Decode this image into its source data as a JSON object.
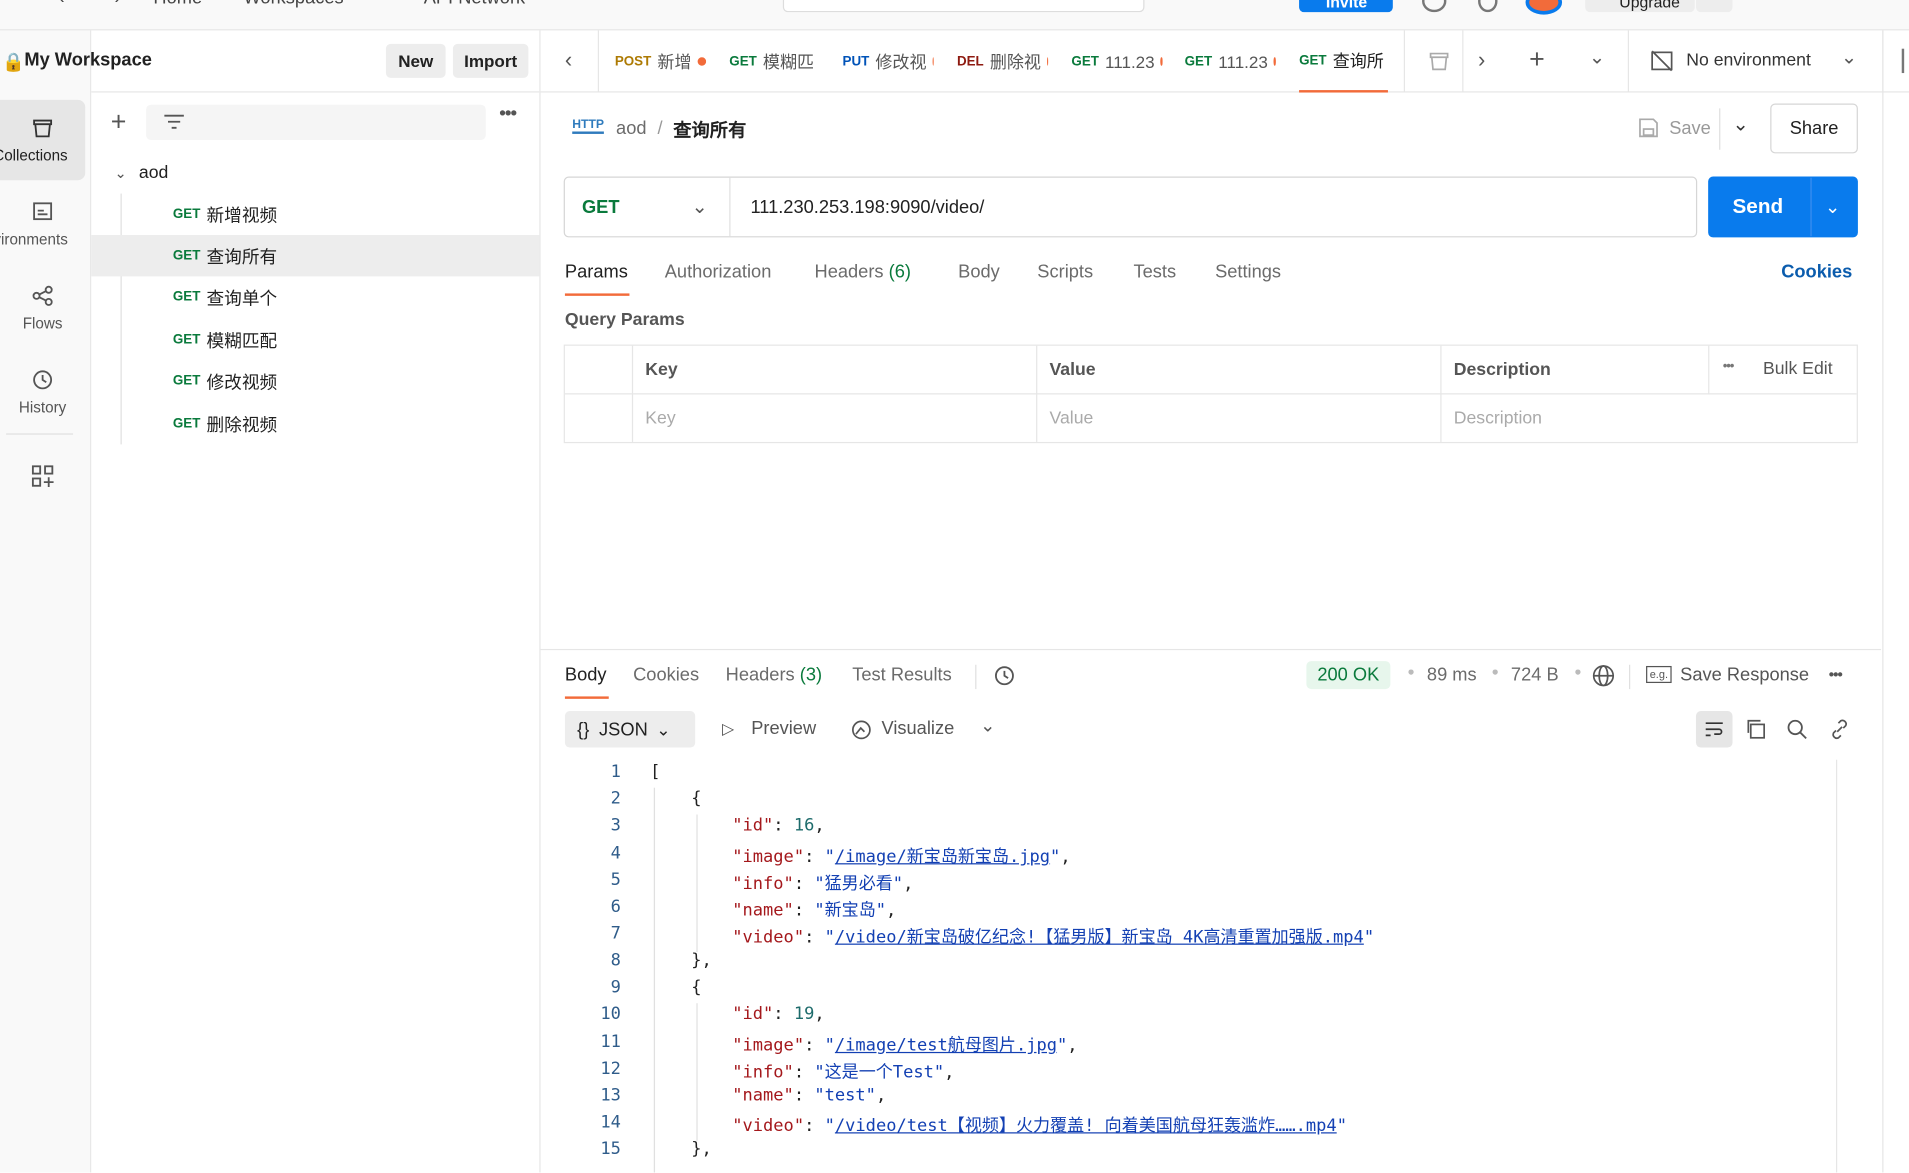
{
  "topbar": {
    "nav": [
      "Home",
      "Workspaces",
      "API Network"
    ],
    "invite": "Invite",
    "upgrade": "Upgrade"
  },
  "workspace": {
    "title": "My Workspace",
    "new_label": "New",
    "import_label": "Import"
  },
  "iconbar": [
    {
      "label": "Collections",
      "icon": "collections-icon"
    },
    {
      "label": "Environments",
      "icon": "environments-icon"
    },
    {
      "label": "Flows",
      "icon": "flows-icon"
    },
    {
      "label": "History",
      "icon": "history-icon"
    }
  ],
  "collection": {
    "name": "aod",
    "requests": [
      {
        "method": "GET",
        "name": "新增视频"
      },
      {
        "method": "GET",
        "name": "查询所有"
      },
      {
        "method": "GET",
        "name": "查询单个"
      },
      {
        "method": "GET",
        "name": "模糊匹配"
      },
      {
        "method": "GET",
        "name": "修改视频"
      },
      {
        "method": "GET",
        "name": "删除视频"
      }
    ]
  },
  "tabs": [
    {
      "method": "POST",
      "name": "新增"
    },
    {
      "method": "GET",
      "name": "模糊匹"
    },
    {
      "method": "PUT",
      "name": "修改视"
    },
    {
      "method": "DEL",
      "name": "删除视"
    },
    {
      "method": "GET",
      "name": "111.23"
    },
    {
      "method": "GET",
      "name": "111.23"
    },
    {
      "method": "GET",
      "name": "查询所"
    }
  ],
  "environment": "No environment",
  "breadcrumb": {
    "collection": "aod",
    "sep": "/",
    "request": "查询所有"
  },
  "actions": {
    "save": "Save",
    "share": "Share"
  },
  "request": {
    "method": "GET",
    "url": "111.230.253.198:9090/video/",
    "send": "Send"
  },
  "req_tabs": {
    "params": "Params",
    "authorization": "Authorization",
    "headers": "Headers",
    "headers_count": "(6)",
    "body": "Body",
    "scripts": "Scripts",
    "tests": "Tests",
    "settings": "Settings",
    "cookies": "Cookies"
  },
  "query_params": {
    "title": "Query Params",
    "headers": {
      "key": "Key",
      "value": "Value",
      "description": "Description",
      "bulk_edit": "Bulk Edit"
    },
    "placeholders": {
      "key": "Key",
      "value": "Value",
      "description": "Description"
    }
  },
  "response": {
    "tabs": {
      "body": "Body",
      "cookies": "Cookies",
      "headers": "Headers",
      "headers_count": "(3)",
      "test_results": "Test Results"
    },
    "status": "200 OK",
    "time": "89 ms",
    "size": "724 B",
    "save_response": "Save Response",
    "format": "JSON",
    "preview": "Preview",
    "visualize": "Visualize",
    "line_numbers": [
      "1",
      "2",
      "3",
      "4",
      "5",
      "6",
      "7",
      "8",
      "9",
      "10",
      "11",
      "12",
      "13",
      "14",
      "15"
    ],
    "items": [
      {
        "id": "16",
        "image": "/image/新宝岛新宝岛.jpg",
        "info": "猛男必看",
        "name": "新宝岛",
        "video": "/video/新宝岛破亿纪念!【猛男版】新宝岛 4K高清重置加强版.mp4"
      },
      {
        "id": "19",
        "image": "/image/test航母图片.jpg",
        "info": "这是一个Test",
        "name": "test",
        "video": "/video/test【视频】火力覆盖! 向着美国航母狂轰滥炸…….mp4"
      }
    ]
  }
}
